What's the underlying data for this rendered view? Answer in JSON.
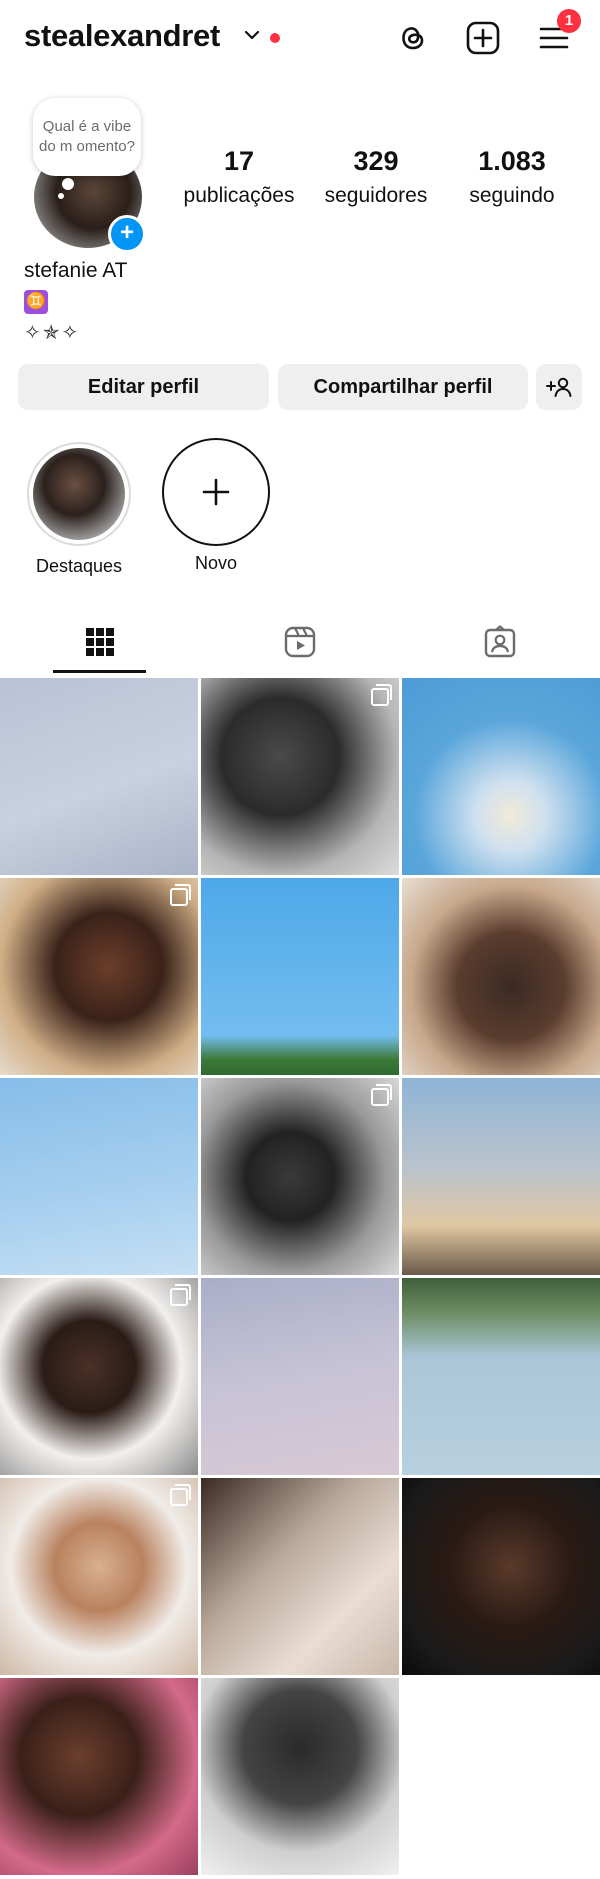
{
  "header": {
    "username": "stealexandret",
    "menu_badge": "1",
    "icons": [
      "chevron-down-icon",
      "threads-icon",
      "create-post-icon",
      "menu-icon"
    ]
  },
  "note": {
    "text": "Qual é a vibe do m omento?"
  },
  "stats": [
    {
      "value": "17",
      "label": "publicações"
    },
    {
      "value": "329",
      "label": "seguidores"
    },
    {
      "value": "1.083",
      "label": "seguindo"
    }
  ],
  "bio": {
    "name": "stefanie AT",
    "emoji": "♊",
    "stars": "✧✯✧"
  },
  "buttons": {
    "edit": "Editar perfil",
    "share": "Compartilhar perfil"
  },
  "highlights": [
    {
      "label": "Destaques"
    },
    {
      "label": "Novo"
    }
  ],
  "tabs": [
    "grid-icon",
    "reels-icon",
    "tagged-icon"
  ],
  "colors": {
    "accent": "#0095f6",
    "notification": "#ff3040",
    "button_bg": "#efefef"
  },
  "posts": [
    {
      "bg": "linear-gradient(160deg,#b9c2d6 0%,#c9d0df 55%,#aab4c9 100%)",
      "multi": false
    },
    {
      "bg": "radial-gradient(circle at 40% 40%,#4a4a4a 0%,#2b2b2b 35%,#b5b5b5 70%,#dcdcdc 100%)",
      "multi": true
    },
    {
      "bg": "radial-gradient(circle at 55% 70%,#f2ead9 0%,#cfe0ef 20%,#5aa6db 55%,#4d9bd6 100%)",
      "multi": false
    },
    {
      "bg": "radial-gradient(circle at 55% 45%,#6b3e2a 0%,#3a2219 35%,#cfae86 70%,#e6dccb 100%)",
      "multi": true
    },
    {
      "bg": "linear-gradient(180deg,#4ea8e8 0%,#73bdf0 80%,#3c7a3a 92%,#2f6a2f 100%)",
      "multi": false
    },
    {
      "bg": "radial-gradient(circle at 55% 55%,#3b2a22 0%,#5a3d2e 35%,#c7a88c 65%,#e8ded2 100%)",
      "multi": false
    },
    {
      "bg": "linear-gradient(170deg,#86bde9 0%,#a8d0ef 60%,#c6dff3 100%)",
      "multi": false
    },
    {
      "bg": "radial-gradient(circle at 45% 50%,#3a3a3a 0%,#222 30%,#9a9a9a 65%,#d8d8d8 100%)",
      "multi": true
    },
    {
      "bg": "linear-gradient(180deg,#8fb4d6 0%,#b9c3cc 45%,#e0c7a3 75%,#6b5a4a 100%)",
      "multi": false
    },
    {
      "bg": "radial-gradient(circle at 45% 45%,#4a3026 0%,#2a1c17 30%,#f2f0ee 60%,#8c8c8c 100%)",
      "multi": true
    },
    {
      "bg": "linear-gradient(170deg,#a9aec8 0%,#c7c3d6 50%,#d8c9d4 100%)",
      "multi": false
    },
    {
      "bg": "linear-gradient(180deg,#3f5f3a 0%,#6e8f65 18%,#a9c6d8 40%,#b7d0df 100%)",
      "multi": false
    },
    {
      "bg": "radial-gradient(circle at 50% 45%,#d9b08f 0%,#b9825f 30%,#f0ece8 60%,#cfb8a5 100%)",
      "multi": true
    },
    {
      "bg": "linear-gradient(135deg,#3a2a22 0%,#b9a89a 40%,#e9ddd3 70%,#c9b8aa 100%)",
      "multi": false
    },
    {
      "bg": "radial-gradient(circle at 55% 45%,#5a3a2a 0%,#2a1a14 40%,#1a1a1a 75%,#0a0a0a 100%)",
      "multi": false
    },
    {
      "bg": "radial-gradient(circle at 40% 40%,#6b3f2e 0%,#3a2018 35%,#d46a8a 70%,#9b3f5e 100%)",
      "multi": false
    },
    {
      "bg": "radial-gradient(circle at 50% 35%,#2a2a2a 0%,#444 35%,#cfcfcf 65%,#f0f0f0 100%)",
      "multi": false
    },
    {
      "bg": "#ffffff",
      "multi": false
    }
  ]
}
